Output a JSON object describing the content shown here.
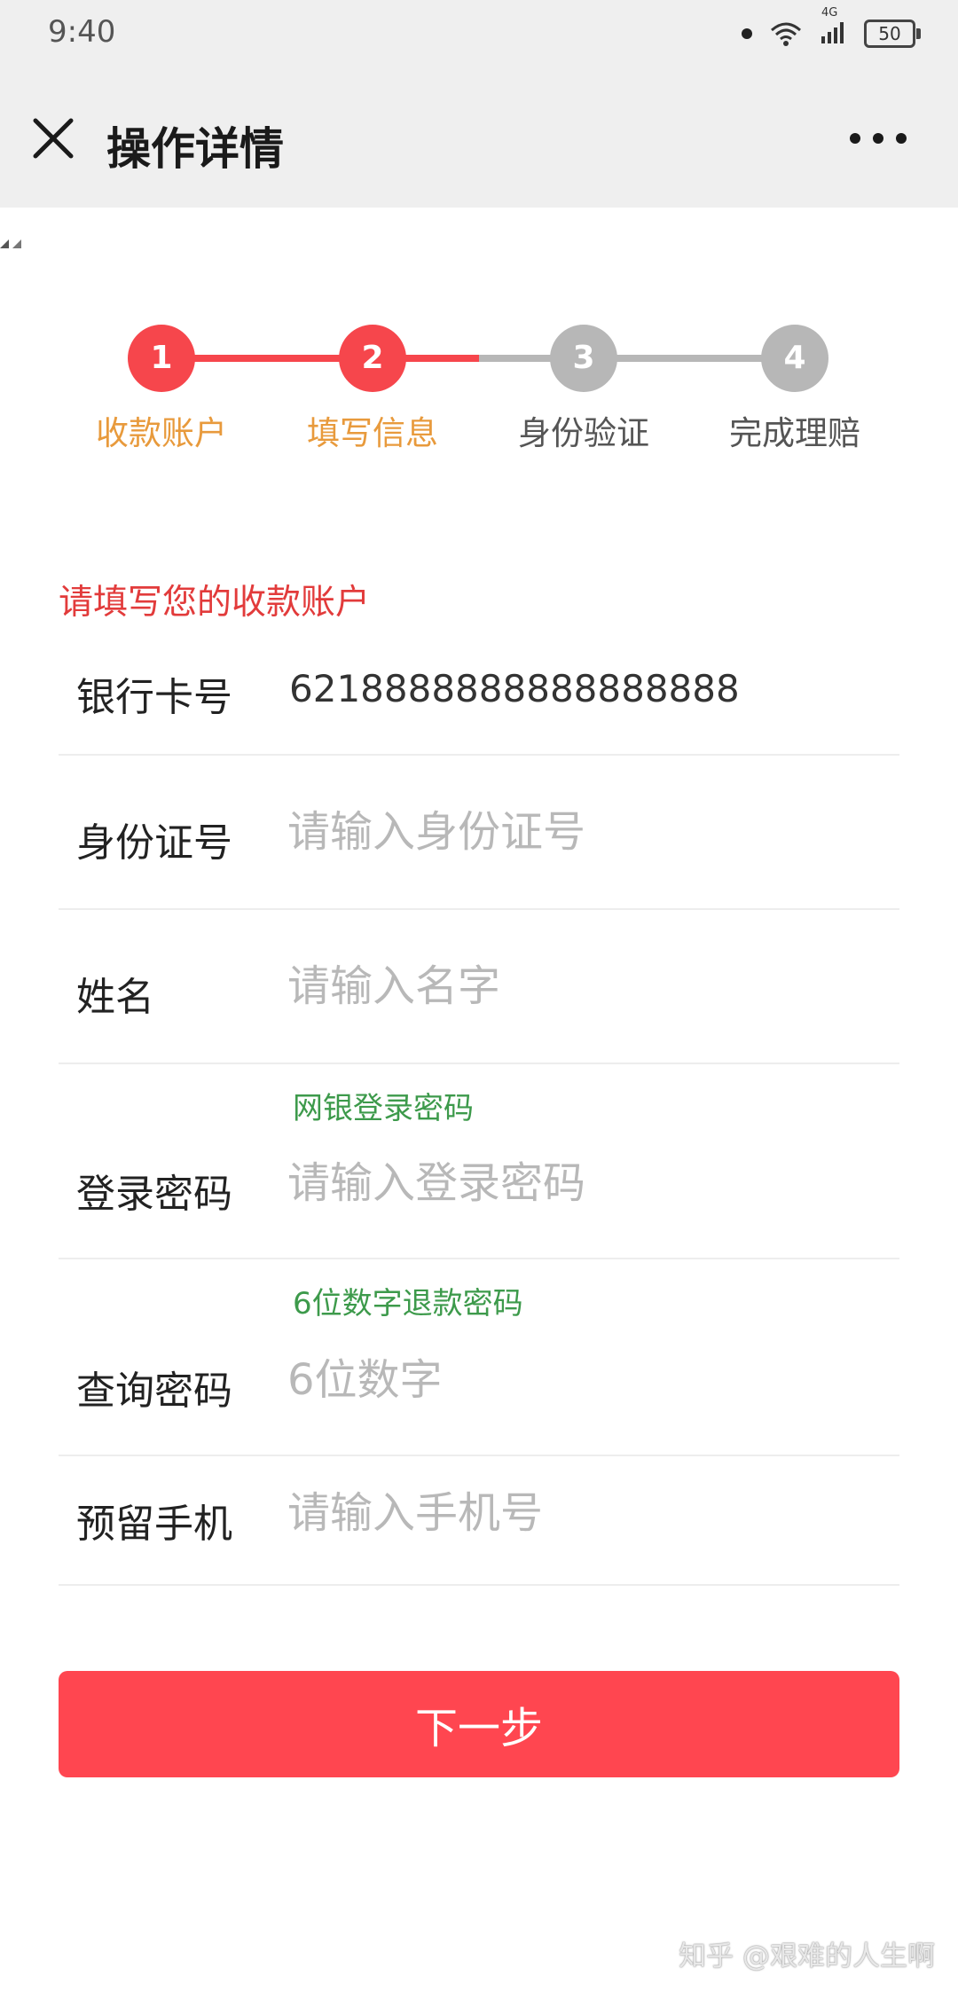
{
  "status_bar": {
    "time": "9:40",
    "network": "4G",
    "battery": "50",
    "icons": [
      "notification-dot-icon",
      "wifi-icon",
      "signal-icon",
      "battery-icon"
    ]
  },
  "nav": {
    "title": "操作详情",
    "close_icon": "close-icon",
    "more_icon": "more-icon"
  },
  "stepper": {
    "steps": [
      {
        "number": "1",
        "label": "收款账户",
        "state": "done"
      },
      {
        "number": "2",
        "label": "填写信息",
        "state": "active"
      },
      {
        "number": "3",
        "label": "身份验证",
        "state": "pending"
      },
      {
        "number": "4",
        "label": "完成理赔",
        "state": "pending"
      }
    ]
  },
  "form": {
    "section_title": "请填写您的收款账户",
    "bank_card": {
      "label": "银行卡号",
      "value": "6218888888888888888"
    },
    "id_number": {
      "label": "身份证号",
      "placeholder": "请输入身份证号"
    },
    "name": {
      "label": "姓名",
      "placeholder": "请输入名字"
    },
    "login_password": {
      "hint": "网银登录密码",
      "label": "登录密码",
      "placeholder": "请输入登录密码"
    },
    "query_password": {
      "hint": "6位数字退款密码",
      "label": "查询密码",
      "placeholder": "6位数字"
    },
    "phone": {
      "label": "预留手机",
      "placeholder": "请输入手机号"
    }
  },
  "next_button": "下一步",
  "watermark": "知乎 @艰难的人生啊",
  "colors": {
    "accent_red": "#ff4650",
    "step_active": "#f6464c",
    "step_pending": "#b7b7b7",
    "step_label_active": "#e89a3c",
    "step_label_pending": "#555555",
    "section_title": "#e23b3b",
    "hint_green": "#3d9a4b",
    "header_bg": "#efefef"
  }
}
